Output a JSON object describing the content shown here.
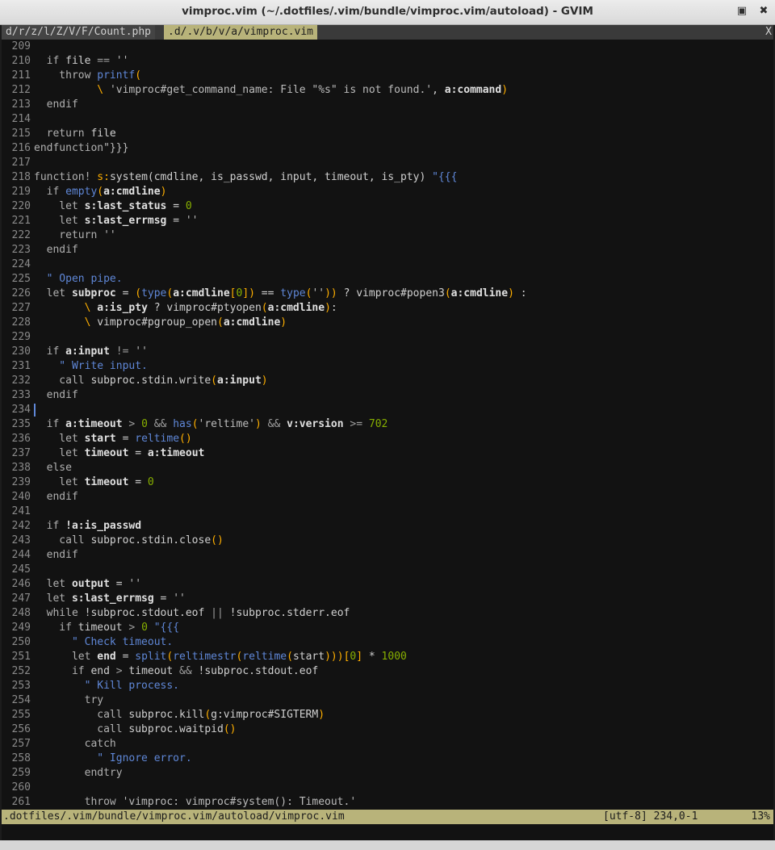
{
  "window": {
    "title": "vimproc.vim (~/.dotfiles/.vim/bundle/vimproc.vim/autoload) - GVIM",
    "max_icon": "▣",
    "close_icon": "✖"
  },
  "tabs": [
    {
      "label": "d/r/z/l/Z/V/F/Count.php"
    },
    {
      "label": ".d/.v/b/v/a/vimproc.vim"
    }
  ],
  "tab_close": "X",
  "status": {
    "path": ".dotfiles/.vim/bundle/vimproc.vim/autoload/vimproc.vim",
    "encoding_pos": "[utf-8] 234,0-1",
    "percent": "13%"
  },
  "cursor_line": 234,
  "lines": [
    {
      "n": 209,
      "t": []
    },
    {
      "n": 210,
      "t": [
        [
          "k",
          "  if "
        ],
        [
          "t",
          "file "
        ],
        [
          "o",
          "=="
        ],
        [
          "t",
          " "
        ],
        [
          "s",
          "''"
        ]
      ]
    },
    {
      "n": 211,
      "t": [
        [
          "k",
          "    throw "
        ],
        [
          "f",
          "printf"
        ],
        [
          "p",
          "("
        ]
      ]
    },
    {
      "n": 212,
      "t": [
        [
          "t",
          "          "
        ],
        [
          "p",
          "\\"
        ],
        [
          "t",
          " "
        ],
        [
          "s",
          "'vimproc#get_command_name: File \"%s\" is not found.'"
        ],
        [
          "t",
          ", "
        ],
        [
          "v",
          "a:command"
        ],
        [
          "p",
          ")"
        ]
      ]
    },
    {
      "n": 213,
      "t": [
        [
          "k",
          "  endif"
        ]
      ]
    },
    {
      "n": 214,
      "t": []
    },
    {
      "n": 215,
      "t": [
        [
          "k",
          "  return "
        ],
        [
          "t",
          "file"
        ]
      ]
    },
    {
      "n": 216,
      "t": [
        [
          "k",
          "endfunction"
        ],
        [
          "s",
          "\"}}}"
        ]
      ]
    },
    {
      "n": 217,
      "t": []
    },
    {
      "n": 218,
      "t": [
        [
          "k",
          "function! "
        ],
        [
          "p",
          "s:"
        ],
        [
          "t",
          "system(cmdline, is_passwd, input, timeout, is_pty) "
        ],
        [
          "c",
          "\"{{{"
        ]
      ]
    },
    {
      "n": 219,
      "t": [
        [
          "k",
          "  if "
        ],
        [
          "f",
          "empty"
        ],
        [
          "p",
          "("
        ],
        [
          "v",
          "a:cmdline"
        ],
        [
          "p",
          ")"
        ]
      ]
    },
    {
      "n": 220,
      "t": [
        [
          "k",
          "    let "
        ],
        [
          "v",
          "s:last_status"
        ],
        [
          "t",
          " = "
        ],
        [
          "n",
          "0"
        ]
      ]
    },
    {
      "n": 221,
      "t": [
        [
          "k",
          "    let "
        ],
        [
          "v",
          "s:last_errmsg"
        ],
        [
          "t",
          " = "
        ],
        [
          "s",
          "''"
        ]
      ]
    },
    {
      "n": 222,
      "t": [
        [
          "k",
          "    return "
        ],
        [
          "s",
          "''"
        ]
      ]
    },
    {
      "n": 223,
      "t": [
        [
          "k",
          "  endif"
        ]
      ]
    },
    {
      "n": 224,
      "t": []
    },
    {
      "n": 225,
      "t": [
        [
          "c",
          "  \" Open pipe."
        ]
      ]
    },
    {
      "n": 226,
      "t": [
        [
          "k",
          "  let "
        ],
        [
          "v",
          "subproc"
        ],
        [
          "t",
          " = "
        ],
        [
          "p",
          "("
        ],
        [
          "f",
          "type"
        ],
        [
          "p",
          "("
        ],
        [
          "v",
          "a:cmdline"
        ],
        [
          "p",
          "["
        ],
        [
          "n",
          "0"
        ],
        [
          "p",
          "])"
        ],
        [
          "t",
          " == "
        ],
        [
          "f",
          "type"
        ],
        [
          "p",
          "("
        ],
        [
          "s",
          "''"
        ],
        [
          "p",
          "))"
        ],
        [
          "t",
          " ? vimproc#popen3"
        ],
        [
          "p",
          "("
        ],
        [
          "v",
          "a:cmdline"
        ],
        [
          "p",
          ")"
        ],
        [
          "t",
          " :"
        ]
      ]
    },
    {
      "n": 227,
      "t": [
        [
          "t",
          "        "
        ],
        [
          "p",
          "\\"
        ],
        [
          "t",
          " "
        ],
        [
          "v",
          "a:is_pty"
        ],
        [
          "t",
          " ? vimproc#ptyopen"
        ],
        [
          "p",
          "("
        ],
        [
          "v",
          "a:cmdline"
        ],
        [
          "p",
          ")"
        ],
        [
          "t",
          ":"
        ]
      ]
    },
    {
      "n": 228,
      "t": [
        [
          "t",
          "        "
        ],
        [
          "p",
          "\\"
        ],
        [
          "t",
          " vimproc#pgroup_open"
        ],
        [
          "p",
          "("
        ],
        [
          "v",
          "a:cmdline"
        ],
        [
          "p",
          ")"
        ]
      ]
    },
    {
      "n": 229,
      "t": []
    },
    {
      "n": 230,
      "t": [
        [
          "k",
          "  if "
        ],
        [
          "v",
          "a:input"
        ],
        [
          "t",
          " "
        ],
        [
          "o",
          "!="
        ],
        [
          "t",
          " "
        ],
        [
          "s",
          "''"
        ]
      ]
    },
    {
      "n": 231,
      "t": [
        [
          "c",
          "    \" Write input."
        ]
      ]
    },
    {
      "n": 232,
      "t": [
        [
          "k",
          "    call "
        ],
        [
          "t",
          "subproc.stdin.write"
        ],
        [
          "p",
          "("
        ],
        [
          "v",
          "a:input"
        ],
        [
          "p",
          ")"
        ]
      ]
    },
    {
      "n": 233,
      "t": [
        [
          "k",
          "  endif"
        ]
      ]
    },
    {
      "n": 234,
      "t": []
    },
    {
      "n": 235,
      "t": [
        [
          "k",
          "  if "
        ],
        [
          "v",
          "a:timeout"
        ],
        [
          "t",
          " "
        ],
        [
          "o",
          ">"
        ],
        [
          "t",
          " "
        ],
        [
          "n",
          "0"
        ],
        [
          "t",
          " "
        ],
        [
          "o",
          "&&"
        ],
        [
          "t",
          " "
        ],
        [
          "f",
          "has"
        ],
        [
          "p",
          "("
        ],
        [
          "s",
          "'reltime'"
        ],
        [
          "p",
          ")"
        ],
        [
          "t",
          " "
        ],
        [
          "o",
          "&&"
        ],
        [
          "t",
          " "
        ],
        [
          "v",
          "v:version"
        ],
        [
          "t",
          " "
        ],
        [
          "o",
          ">="
        ],
        [
          "t",
          " "
        ],
        [
          "n",
          "702"
        ]
      ]
    },
    {
      "n": 236,
      "t": [
        [
          "k",
          "    let "
        ],
        [
          "v",
          "start"
        ],
        [
          "t",
          " = "
        ],
        [
          "f",
          "reltime"
        ],
        [
          "p",
          "()"
        ]
      ]
    },
    {
      "n": 237,
      "t": [
        [
          "k",
          "    let "
        ],
        [
          "v",
          "timeout"
        ],
        [
          "t",
          " = "
        ],
        [
          "v",
          "a:timeout"
        ]
      ]
    },
    {
      "n": 238,
      "t": [
        [
          "k",
          "  else"
        ]
      ]
    },
    {
      "n": 239,
      "t": [
        [
          "k",
          "    let "
        ],
        [
          "v",
          "timeout"
        ],
        [
          "t",
          " = "
        ],
        [
          "n",
          "0"
        ]
      ]
    },
    {
      "n": 240,
      "t": [
        [
          "k",
          "  endif"
        ]
      ]
    },
    {
      "n": 241,
      "t": []
    },
    {
      "n": 242,
      "t": [
        [
          "k",
          "  if "
        ],
        [
          "v",
          "!a:is_passwd"
        ]
      ]
    },
    {
      "n": 243,
      "t": [
        [
          "k",
          "    call "
        ],
        [
          "t",
          "subproc.stdin.close"
        ],
        [
          "p",
          "()"
        ]
      ]
    },
    {
      "n": 244,
      "t": [
        [
          "k",
          "  endif"
        ]
      ]
    },
    {
      "n": 245,
      "t": []
    },
    {
      "n": 246,
      "t": [
        [
          "k",
          "  let "
        ],
        [
          "v",
          "output"
        ],
        [
          "t",
          " = "
        ],
        [
          "s",
          "''"
        ]
      ]
    },
    {
      "n": 247,
      "t": [
        [
          "k",
          "  let "
        ],
        [
          "v",
          "s:last_errmsg"
        ],
        [
          "t",
          " = "
        ],
        [
          "s",
          "''"
        ]
      ]
    },
    {
      "n": 248,
      "t": [
        [
          "k",
          "  while "
        ],
        [
          "t",
          "!subproc.stdout.eof "
        ],
        [
          "o",
          "||"
        ],
        [
          "t",
          " !subproc.stderr.eof"
        ]
      ]
    },
    {
      "n": 249,
      "t": [
        [
          "k",
          "    if "
        ],
        [
          "t",
          "timeout "
        ],
        [
          "o",
          ">"
        ],
        [
          "t",
          " "
        ],
        [
          "n",
          "0"
        ],
        [
          "t",
          " "
        ],
        [
          "c",
          "\"{{{"
        ]
      ]
    },
    {
      "n": 250,
      "t": [
        [
          "c",
          "      \" Check timeout."
        ]
      ]
    },
    {
      "n": 251,
      "t": [
        [
          "k",
          "      let "
        ],
        [
          "v",
          "end"
        ],
        [
          "t",
          " = "
        ],
        [
          "f",
          "split"
        ],
        [
          "p",
          "("
        ],
        [
          "f",
          "reltimestr"
        ],
        [
          "p",
          "("
        ],
        [
          "f",
          "reltime"
        ],
        [
          "p",
          "("
        ],
        [
          "t",
          "start"
        ],
        [
          "p",
          ")))["
        ],
        [
          "n",
          "0"
        ],
        [
          "p",
          "]"
        ],
        [
          "t",
          " * "
        ],
        [
          "n",
          "1000"
        ]
      ]
    },
    {
      "n": 252,
      "t": [
        [
          "k",
          "      if "
        ],
        [
          "t",
          "end "
        ],
        [
          "o",
          ">"
        ],
        [
          "t",
          " timeout "
        ],
        [
          "o",
          "&&"
        ],
        [
          "t",
          " !subproc.stdout.eof"
        ]
      ]
    },
    {
      "n": 253,
      "t": [
        [
          "c",
          "        \" Kill process."
        ]
      ]
    },
    {
      "n": 254,
      "t": [
        [
          "k",
          "        try"
        ]
      ]
    },
    {
      "n": 255,
      "t": [
        [
          "k",
          "          call "
        ],
        [
          "t",
          "subproc.kill"
        ],
        [
          "p",
          "("
        ],
        [
          "t",
          "g:vimproc#SIGTERM"
        ],
        [
          "p",
          ")"
        ]
      ]
    },
    {
      "n": 256,
      "t": [
        [
          "k",
          "          call "
        ],
        [
          "t",
          "subproc.waitpid"
        ],
        [
          "p",
          "()"
        ]
      ]
    },
    {
      "n": 257,
      "t": [
        [
          "k",
          "        catch"
        ]
      ]
    },
    {
      "n": 258,
      "t": [
        [
          "c",
          "          \" Ignore error."
        ]
      ]
    },
    {
      "n": 259,
      "t": [
        [
          "k",
          "        endtry"
        ]
      ]
    },
    {
      "n": 260,
      "t": []
    },
    {
      "n": 261,
      "t": [
        [
          "k",
          "        throw "
        ],
        [
          "s",
          "'vimproc: vimproc#system(): Timeout.'"
        ]
      ]
    }
  ]
}
